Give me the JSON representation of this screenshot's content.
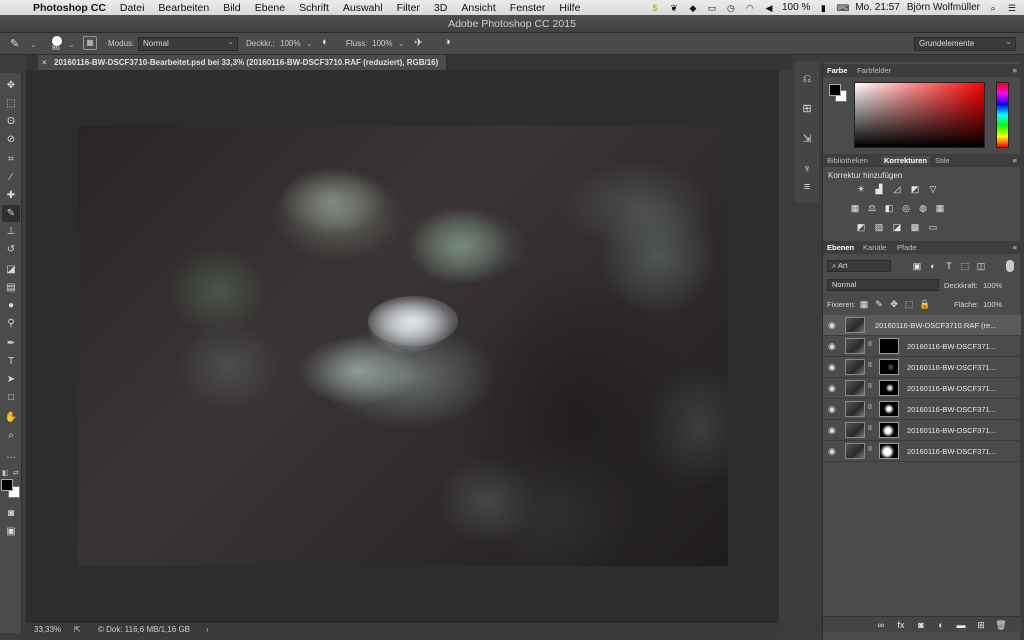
{
  "menubar": {
    "app": "Photoshop CC",
    "items": [
      "Datei",
      "Bearbeiten",
      "Bild",
      "Ebene",
      "Schrift",
      "Auswahl",
      "Filter",
      "3D",
      "Ansicht",
      "Fenster",
      "Hilfe"
    ],
    "battery": "100 %",
    "clock": "Mo. 21:57",
    "user": "Björn Wolfmüller"
  },
  "window": {
    "title": "Adobe Photoshop CC 2015"
  },
  "options": {
    "brush_size": "86",
    "modus_label": "Modus:",
    "modus_value": "Normal",
    "deckkr_label": "Deckkr.:",
    "deckkr_value": "100%",
    "fluss_label": "Fluss:",
    "fluss_value": "100%",
    "workspace": "Grundelemente"
  },
  "document": {
    "tab_label": "20160116-BW-DSCF3710-Bearbeitet.psd bei 33,3% (20160116-BW-DSCF3710.RAF (reduziert), RGB/16)"
  },
  "status": {
    "zoom": "33,33%",
    "doc_info": "© Dok: 116,6 MB/1,16 GB"
  },
  "color_panel": {
    "tabs": [
      "Farbe",
      "Farbfelder"
    ],
    "active": "Farbe"
  },
  "adjust_panel": {
    "tabs": [
      "Bibliotheken",
      "Korrekturen",
      "Stile"
    ],
    "active": "Korrekturen",
    "heading": "Korrektur hinzufügen"
  },
  "layers_panel": {
    "tabs": [
      "Ebenen",
      "Kanäle",
      "Pfade"
    ],
    "active": "Ebenen",
    "filter_label": "Art",
    "blend_mode": "Normal",
    "opacity_label": "Deckkraft:",
    "opacity_value": "100%",
    "lock_label": "Fixieren:",
    "fill_label": "Fläche:",
    "fill_value": "100%",
    "layers": [
      {
        "name": "20160116-BW-DSCF3710.RAF (re...",
        "selected": true,
        "has_mask": false
      },
      {
        "name": "20160116-BW-DSCF371...",
        "selected": false,
        "has_mask": true
      },
      {
        "name": "20160116-BW-DSCF371...",
        "selected": false,
        "has_mask": true
      },
      {
        "name": "20160116-BW-DSCF371...",
        "selected": false,
        "has_mask": true
      },
      {
        "name": "20160116-BW-DSCF371...",
        "selected": false,
        "has_mask": true
      },
      {
        "name": "20160116-BW-DSCF371...",
        "selected": false,
        "has_mask": true
      },
      {
        "name": "20160116-BW-DSCF371...",
        "selected": false,
        "has_mask": true
      }
    ]
  },
  "icons": {
    "tools": [
      "move-icon",
      "marquee-icon",
      "lasso-icon",
      "quick-select-icon",
      "crop-icon",
      "eyedropper-icon",
      "healing-icon",
      "brush-icon",
      "stamp-icon",
      "history-brush-icon",
      "eraser-icon",
      "gradient-icon",
      "blur-icon",
      "dodge-icon",
      "pen-icon",
      "type-icon",
      "path-select-icon",
      "rectangle-icon",
      "hand-icon",
      "zoom-icon",
      "more-icon"
    ]
  }
}
